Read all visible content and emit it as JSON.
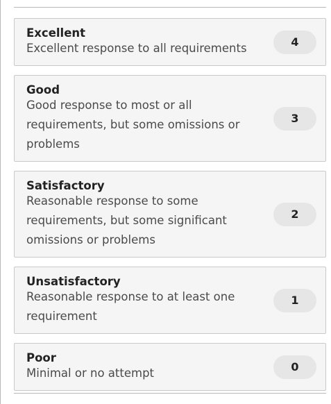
{
  "criteria": [
    {
      "title": "Excellent",
      "description": "Excellent response to all requirements",
      "points": "4"
    },
    {
      "title": "Good",
      "description": "Good response to most or all requirements, but some omissions or problems",
      "points": "3"
    },
    {
      "title": "Satisfactory",
      "description": "Reasonable response to some requirements, but some significant omissions or problems",
      "points": "2"
    },
    {
      "title": "Unsatisfactory",
      "description": "Reasonable response to at least one requirement",
      "points": "1"
    },
    {
      "title": "Poor",
      "description": "Minimal or no attempt",
      "points": "0"
    }
  ]
}
